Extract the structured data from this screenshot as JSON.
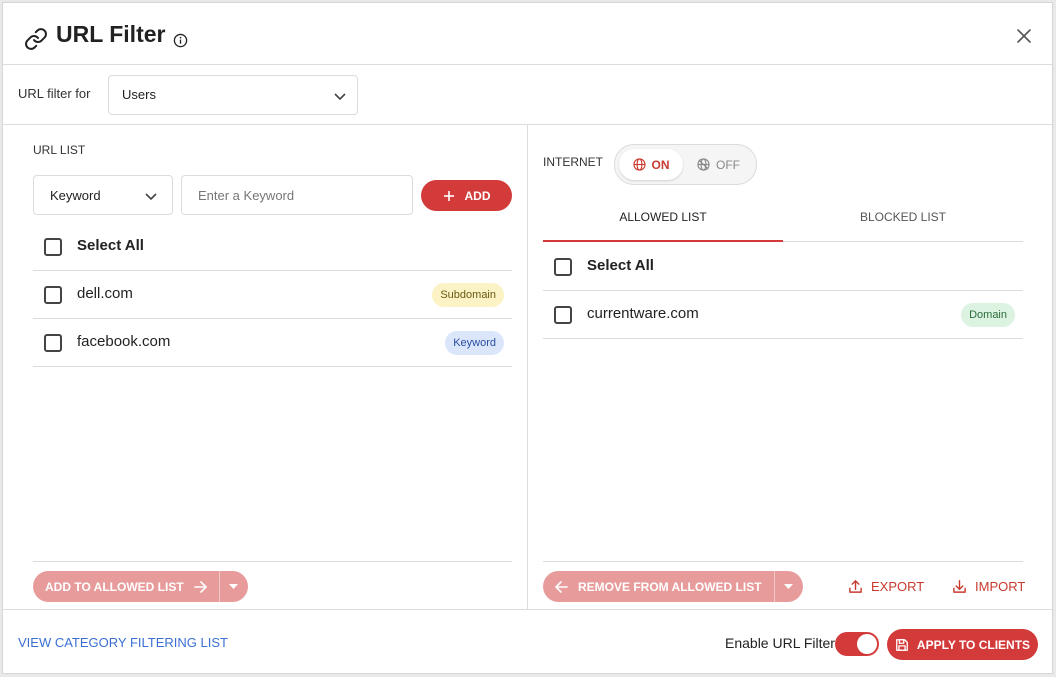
{
  "dialog": {
    "title": "URL Filter",
    "title_icon": "link-icon",
    "info_icon": "info-icon",
    "close_icon": "close-icon"
  },
  "filter": {
    "label": "URL filter for",
    "selected": "Users"
  },
  "url_list": {
    "heading": "URL LIST",
    "type_selected": "Keyword",
    "input_placeholder": "Enter a Keyword",
    "add_label": "ADD",
    "select_all": "Select All",
    "items": [
      {
        "text": "dell.com",
        "badge": "Subdomain"
      },
      {
        "text": "facebook.com",
        "badge": "Keyword"
      }
    ],
    "add_to_allowed_label": "ADD TO ALLOWED LIST"
  },
  "internet": {
    "label": "INTERNET",
    "on_label": "ON",
    "off_label": "OFF",
    "state": "on"
  },
  "tabs": [
    {
      "label": "ALLOWED LIST",
      "active": true
    },
    {
      "label": "BLOCKED LIST",
      "active": false
    }
  ],
  "allowed_list": {
    "select_all": "Select All",
    "items": [
      {
        "text": "currentware.com",
        "badge": "Domain"
      }
    ],
    "remove_label": "REMOVE FROM ALLOWED LIST",
    "export_label": "EXPORT",
    "import_label": "IMPORT"
  },
  "footer": {
    "category_link": "VIEW CATEGORY FILTERING LIST",
    "enable_label": "Enable URL Filter",
    "enabled": true,
    "apply_label": "APPLY TO CLIENTS"
  },
  "colors": {
    "accent": "#d33b3b",
    "accent_muted": "#e89b9b",
    "link": "#3b6fd4"
  }
}
